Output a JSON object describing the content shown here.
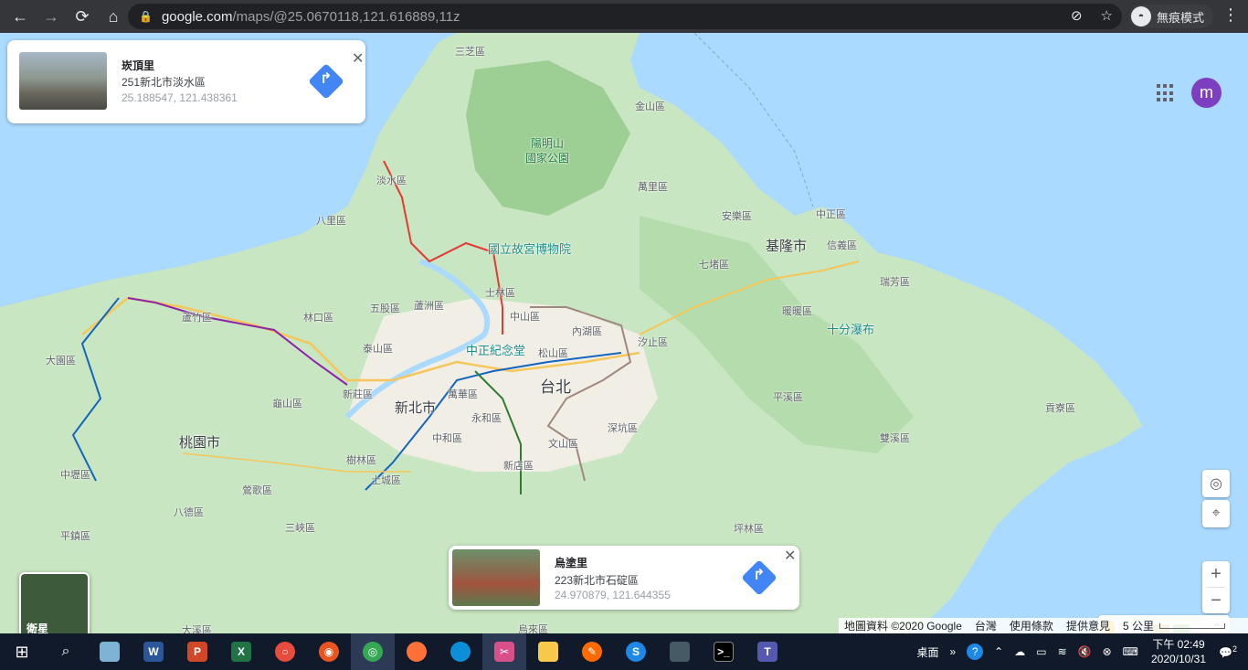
{
  "browser": {
    "url_host": "google.com",
    "url_path": "/maps/@25.0670118,121.616889,11z",
    "incognito_label": "無痕模式"
  },
  "map": {
    "labels": {
      "sanzhi": "三芝區",
      "jinshan": "金山區",
      "yangmingshan": "陽明山",
      "national_park": "國家公園",
      "tamsui": "淡水區",
      "wanli": "萬里區",
      "bali": "八里區",
      "anle": "安樂區",
      "zhongzheng_kl": "中正區",
      "keelung": "基隆市",
      "xinyi_kl": "信義區",
      "palace_museum": "國立故宮博物院",
      "shilin": "士林區",
      "qidu": "七堵區",
      "ruifang": "瑞芳區",
      "luzhu": "蘆竹區",
      "wugu": "五股區",
      "luzhou": "蘆洲區",
      "linkou": "林口區",
      "zhongshan": "中山區",
      "neihu": "內湖區",
      "nuannuan": "暖暖區",
      "cks_memorial": "中正紀念堂",
      "taishan": "泰山區",
      "songshan": "松山區",
      "xizhi": "汐止區",
      "shifen": "十分瀑布",
      "dayuan": "大園區",
      "xinzhuang": "新莊區",
      "newtaipei": "新北市",
      "taipei": "台北",
      "wanhua": "萬華區",
      "guishan": "龜山區",
      "pingxi": "平溪區",
      "gongliao": "貢寮區",
      "yonghe": "永和區",
      "shenkeng": "深坑區",
      "taoyuan_city": "桃園市",
      "zhonghe": "中和區",
      "shulin": "樹林區",
      "wenshan": "文山區",
      "shuangxi": "雙溪區",
      "zhongli": "中壢區",
      "xindian": "新店區",
      "tucheng": "土城區",
      "yingge": "鶯歌區",
      "bade": "八德區",
      "sanxia": "三峽區",
      "pingzhen": "平鎮區",
      "pinglin": "坪林區",
      "daxi": "大溪區",
      "wulai": "烏來區"
    },
    "top_card": {
      "title": "崁頂里",
      "address": "251新北市淡水區",
      "coords": "25.188547, 121.438361"
    },
    "bottom_card": {
      "title": "烏塗里",
      "address": "223新北市石碇區",
      "coords": "24.970879, 121.644355"
    },
    "avatar_letter": "m",
    "satellite_label": "衛星",
    "footer": {
      "data": "地圖資料 ©2020 Google",
      "region": "台灣",
      "terms": "使用條款",
      "feedback": "提供意見",
      "scale": "5 公里"
    }
  },
  "taskbar": {
    "desktop_label": "桌面",
    "time": "下午 02:49",
    "date": "2020/10/31",
    "notif_count": "2"
  }
}
